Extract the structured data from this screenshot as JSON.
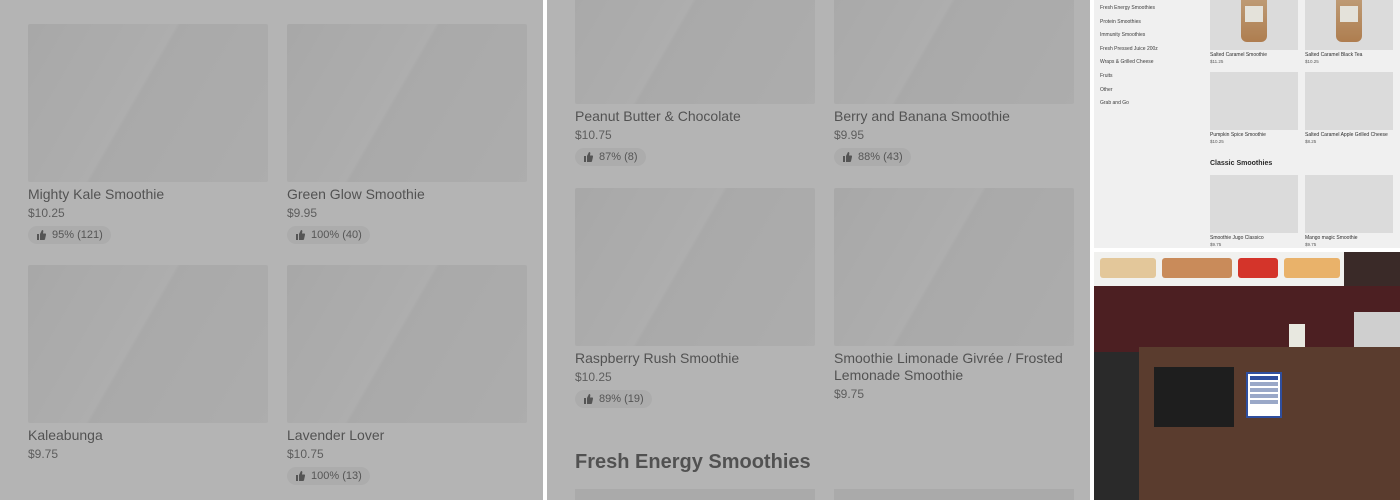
{
  "panel1": {
    "cards": [
      {
        "name": "Mighty Kale Smoothie",
        "price": "$10.25",
        "rating": "95% (121)"
      },
      {
        "name": "Green Glow Smoothie",
        "price": "$9.95",
        "rating": "100% (40)"
      },
      {
        "name": "Kaleabunga",
        "price": "$9.75",
        "rating": ""
      },
      {
        "name": "Lavender Lover",
        "price": "$10.75",
        "rating": "100% (13)"
      }
    ]
  },
  "panel2": {
    "cards": [
      {
        "name": "Peanut Butter & Chocolate",
        "price": "$10.75",
        "rating": "87% (8)"
      },
      {
        "name": "Berry and Banana Smoothie",
        "price": "$9.95",
        "rating": "88% (43)"
      },
      {
        "name": "Raspberry Rush Smoothie",
        "price": "$10.25",
        "rating": "89% (19)"
      },
      {
        "name": "Smoothie Limonade Givrée  / Frosted Lemonade Smoothie",
        "price": "$9.75",
        "rating": ""
      }
    ],
    "section_title": "Fresh Energy Smoothies"
  },
  "panel3": {
    "nav": [
      "Fresh Energy Smoothies",
      "Protein Smoothies",
      "Immunity Smoothies",
      "Fresh Pressed Juice 200z",
      "Wraps & Grilled Cheese",
      "Fruits",
      "Other",
      "Grab and Go"
    ],
    "cards": [
      {
        "name": "Salted Caramel Smoothie",
        "price": "$11.25"
      },
      {
        "name": "Salted Caramel Black Tea",
        "price": "$10.25"
      },
      {
        "name": "Pumpkin Spice Smoothie",
        "price": "$10.25"
      },
      {
        "name": "Salted Caramel Apple Grilled Cheese",
        "price": "$8.25"
      },
      {
        "name": "Smoothie Jugo Classico",
        "price": "$9.75"
      },
      {
        "name": "Mango magic Smoothie",
        "price": "$9.75"
      }
    ],
    "section_title": "Classic Smoothies"
  },
  "colors": {
    "overlay": "#808080",
    "rating_bg": "#e2e2e2",
    "sign_blue": "#2f4f9f"
  },
  "icons": {
    "rating": "thumbs-up-icon"
  }
}
